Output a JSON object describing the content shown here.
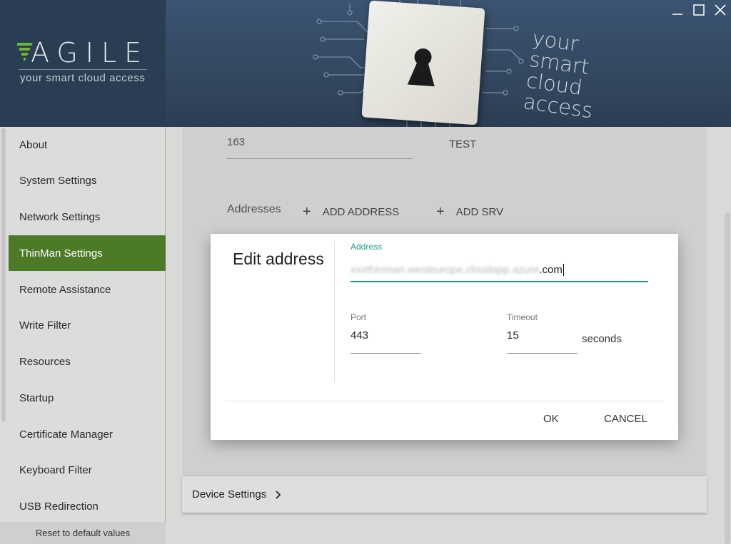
{
  "header": {
    "logo_text": "AGILE",
    "logo_tagline": "your smart cloud access",
    "banner_slogan": [
      "your",
      "smart",
      "cloud",
      "access"
    ],
    "window_controls": [
      "minimize-icon",
      "maximize-icon",
      "close-icon"
    ]
  },
  "sidebar": {
    "items": [
      {
        "label": "About"
      },
      {
        "label": "System Settings"
      },
      {
        "label": "Network Settings"
      },
      {
        "label": "ThinMan Settings",
        "active": true
      },
      {
        "label": "Remote Assistance"
      },
      {
        "label": "Write Filter"
      },
      {
        "label": "Resources"
      },
      {
        "label": "Startup"
      },
      {
        "label": "Certificate Manager"
      },
      {
        "label": "Keyboard Filter"
      },
      {
        "label": "USB Redirection"
      }
    ],
    "reset_label": "Reset to default values",
    "active_color": "#4d7a27"
  },
  "main": {
    "field_value": "163",
    "test_label": "TEST",
    "addresses_label": "Addresses",
    "add_address_label": "ADD ADDRESS",
    "add_srv_label": "ADD SRV",
    "device_settings_label": "Device Settings"
  },
  "dialog": {
    "title": "Edit address",
    "address_label": "Address",
    "address_value_blurred": "xxxthinman.westeurope.cloudapp.azure",
    "address_value_suffix": ".com",
    "port_label": "Port",
    "port_value": "443",
    "timeout_label": "Timeout",
    "timeout_value": "15",
    "timeout_unit": "seconds",
    "ok_label": "OK",
    "cancel_label": "CANCEL",
    "accent_color": "#1f9e86"
  }
}
